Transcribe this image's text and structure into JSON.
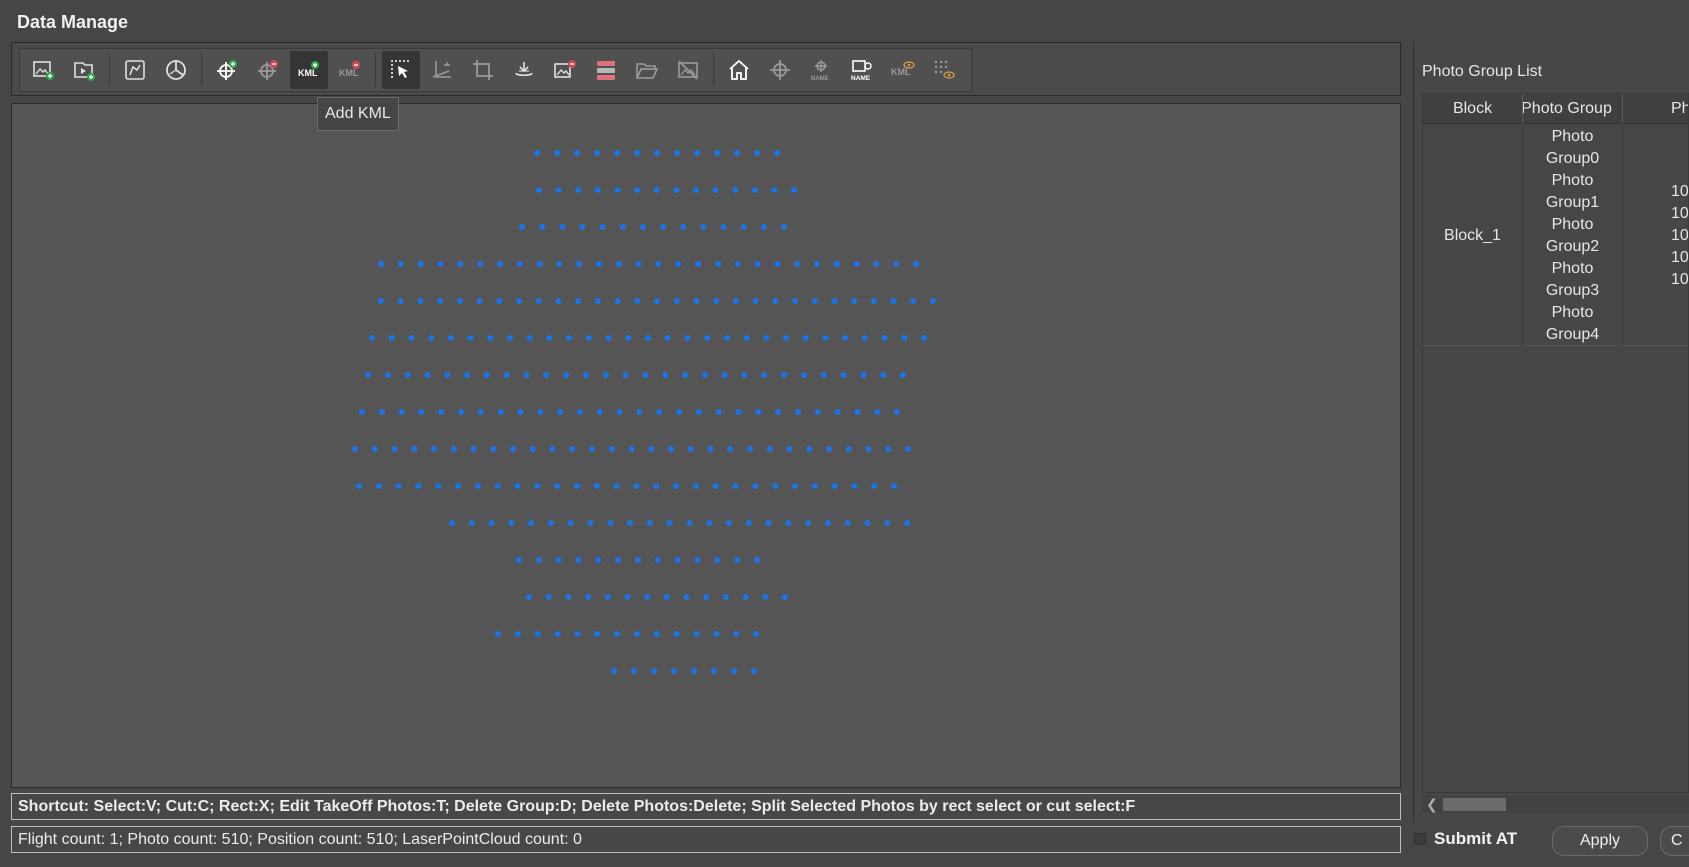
{
  "window": {
    "title": "Data Manage"
  },
  "toolbar": {
    "groups": [
      [
        {
          "icon": "add-photo-icon",
          "color": "#e0e0e0"
        },
        {
          "icon": "add-video-icon",
          "color": "#e0e0e0"
        }
      ],
      [
        {
          "icon": "edit-region-icon",
          "color": "#e0e0e0"
        },
        {
          "icon": "pie-chart-icon",
          "color": "#e0e0e0"
        }
      ],
      [
        {
          "icon": "add-position-icon",
          "color": "#ffffff"
        },
        {
          "icon": "delete-position-icon",
          "color": "#9a9a9a"
        },
        {
          "icon": "add-kml-icon",
          "color": "#ffffff",
          "active": true
        },
        {
          "icon": "delete-kml-icon",
          "color": "#9a9a9a"
        }
      ],
      [
        {
          "icon": "select-arrow-icon",
          "color": "#ffffff",
          "active": true
        },
        {
          "icon": "cut-icon",
          "color": "#9a9a9a"
        },
        {
          "icon": "crop-rect-icon",
          "color": "#9a9a9a"
        },
        {
          "icon": "takeoff-icon",
          "color": "#e0e0e0"
        },
        {
          "icon": "delete-photos-icon",
          "color": "#e0e0e0"
        },
        {
          "icon": "delete-group-icon",
          "color": "#e0707a"
        },
        {
          "icon": "open-folder-icon",
          "color": "#9a9a9a"
        },
        {
          "icon": "hide-image-icon",
          "color": "#9a9a9a"
        }
      ],
      [
        {
          "icon": "home-icon",
          "color": "#ffffff"
        },
        {
          "icon": "center-target-icon",
          "color": "#9a9a9a"
        },
        {
          "icon": "position-name-icon",
          "color": "#9a9a9a"
        },
        {
          "icon": "show-name-icon",
          "color": "#ffffff"
        },
        {
          "icon": "kml-visibility-icon",
          "color": "#9a9a9a"
        },
        {
          "icon": "point-visibility-icon",
          "color": "#9a9a9a"
        }
      ]
    ],
    "tooltip": "Add KML"
  },
  "map": {
    "point_color": "#1a73e8",
    "rows": [
      {
        "xs": [
          536,
          776
        ],
        "n": 13
      },
      {
        "xs": [
          538,
          793
        ],
        "n": 14
      },
      {
        "xs": [
          521,
          783
        ],
        "n": 14
      },
      {
        "xs": [
          380,
          915
        ],
        "n": 28
      },
      {
        "xs": [
          380,
          932
        ],
        "n": 29
      },
      {
        "xs": [
          371,
          923
        ],
        "n": 29
      },
      {
        "xs": [
          367,
          902
        ],
        "n": 28
      },
      {
        "xs": [
          361,
          896
        ],
        "n": 28
      },
      {
        "xs": [
          354,
          907
        ],
        "n": 29
      },
      {
        "xs": [
          358,
          893
        ],
        "n": 28
      },
      {
        "xs": [
          451,
          906
        ],
        "n": 24
      },
      {
        "xs": [
          518,
          756
        ],
        "n": 13
      },
      {
        "xs": [
          528,
          784
        ],
        "n": 14
      },
      {
        "xs": [
          497,
          755
        ],
        "n": 14
      },
      {
        "xs": [
          613,
          753
        ],
        "n": 8
      }
    ],
    "row_y_start": 152,
    "row_y_step": 37
  },
  "status": {
    "shortcut": "Shortcut: Select:V; Cut:C; Rect:X; Edit TakeOff Photos:T; Delete Group:D; Delete Photos:Delete; Split Selected Photos by rect select or cut select:F",
    "counts": "Flight count: 1; Photo count: 510; Position count: 510; LaserPointCloud count: 0"
  },
  "photo_group_panel": {
    "title": "Photo Group List",
    "columns": [
      "Block",
      "Photo Group",
      "Pho"
    ],
    "rows": [
      {
        "block": "Block_1",
        "groups": [
          "Photo",
          "Group0",
          "Photo",
          "Group1",
          "Photo",
          "Group2",
          "Photo",
          "Group3",
          "Photo",
          "Group4"
        ],
        "counts": [
          "10",
          "10",
          "10",
          "10",
          "10"
        ]
      }
    ]
  },
  "footer": {
    "submit_label": "Submit AT",
    "apply_label": "Apply",
    "cancel_label": "C"
  }
}
